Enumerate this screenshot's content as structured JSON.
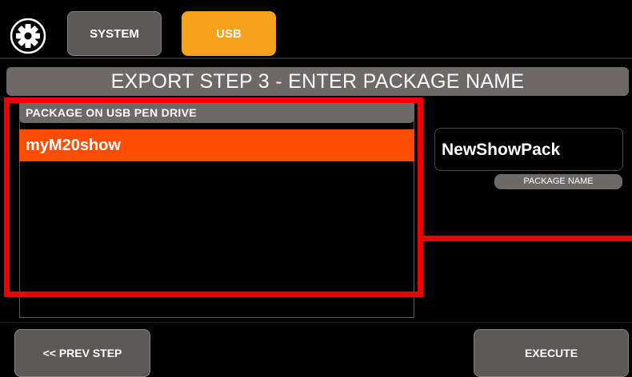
{
  "tabs": {
    "system_label": "SYSTEM",
    "usb_label": "USB"
  },
  "header": {
    "title": "EXPORT STEP 3 - ENTER PACKAGE NAME"
  },
  "package_list": {
    "title": "PACKAGE ON USB PEN DRIVE",
    "items": [
      "myM20show"
    ],
    "selected_index": 0
  },
  "package_name": {
    "value": "NewShowPack",
    "label": "PACKAGE NAME"
  },
  "buttons": {
    "prev_label": "<< PREV STEP",
    "execute_label": "EXECUTE"
  },
  "icons": {
    "settings": "gear-icon"
  },
  "colors": {
    "accent_tab": "#f7a21b",
    "selected_item": "#ff4d00",
    "highlight": "#ee0000",
    "panel_gray": "#6e6968"
  }
}
